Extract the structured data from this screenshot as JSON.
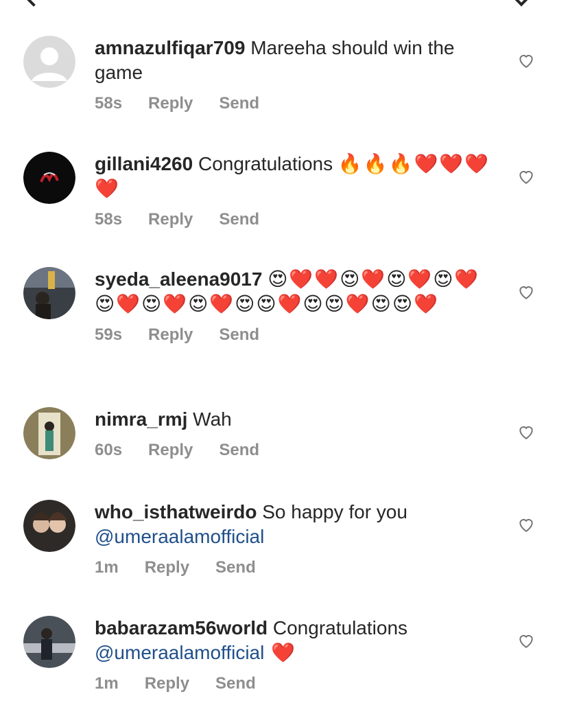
{
  "comments": [
    {
      "username": "amnazulfiqar709",
      "text": " Mareeha should win the game",
      "mention": "",
      "emojis": "",
      "time": "58s",
      "reply": "Reply",
      "send": "Send"
    },
    {
      "username": "gillani4260",
      "text": " Congratulations ",
      "mention": "",
      "emojis": "🔥🔥🔥❤️❤️❤️❤️",
      "time": "58s",
      "reply": "Reply",
      "send": "Send"
    },
    {
      "username": "syeda_aleena9017",
      "text": " ",
      "mention": "",
      "emojis": "😍❤️❤️😍❤️😍❤️😍❤️😍❤️😍❤️😍❤️😍😍❤️😍😍❤️😍😍❤️",
      "time": "59s",
      "reply": "Reply",
      "send": "Send"
    },
    {
      "username": "nimra_rmj",
      "text": " Wah",
      "mention": "",
      "emojis": "",
      "time": "60s",
      "reply": "Reply",
      "send": "Send"
    },
    {
      "username": "who_isthatweirdo",
      "text": " So happy for you ",
      "mention": "@umeraalamofficial",
      "emojis": "",
      "time": "1m",
      "reply": "Reply",
      "send": "Send"
    },
    {
      "username": "babarazam56world",
      "text": " Congratulations ",
      "mention": "@umeraalamofficial",
      "emojis": " ❤️",
      "time": "1m",
      "reply": "Reply",
      "send": "Send"
    }
  ],
  "icons": {
    "like": "heart-outline-icon",
    "back": "chevron-left-icon",
    "options": "chevron-down-icon"
  },
  "colors": {
    "text": "#262626",
    "meta": "#8e8e8e",
    "mention": "#1f4f8a"
  }
}
